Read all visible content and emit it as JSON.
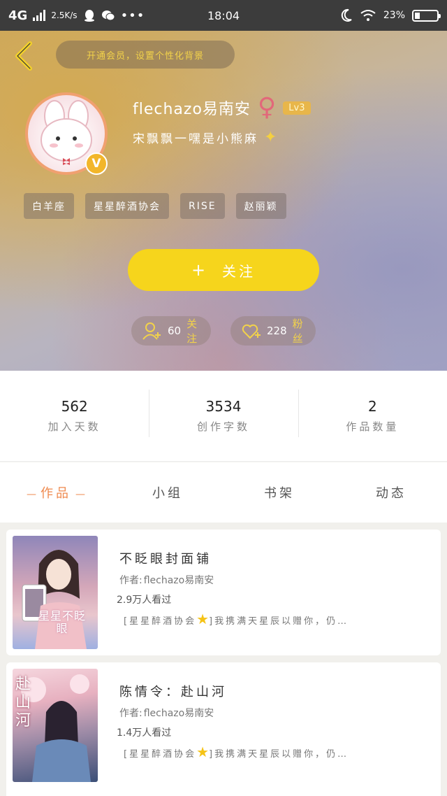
{
  "status_bar": {
    "network": "4G",
    "speed": "2.5K/s",
    "time": "18:04",
    "battery_percent": "23%",
    "battery_level": 0.23
  },
  "header": {
    "vip_banner": "开通会员，设置个性化背景",
    "username": "flechazo易南安",
    "gender_symbol": "♀",
    "level": "Lv3",
    "signature": "宋飘飘一嘿是小熊麻",
    "avatar_badge": "V",
    "tags": [
      "白羊座",
      "星星醉酒协会",
      "RISE",
      "赵丽颖"
    ],
    "follow_label": "关注",
    "following_count": "60",
    "following_label": "关注",
    "fans_count": "228",
    "fans_label": "粉丝"
  },
  "stats": [
    {
      "value": "562",
      "label": "加入天数"
    },
    {
      "value": "3534",
      "label": "创作字数"
    },
    {
      "value": "2",
      "label": "作品数量"
    }
  ],
  "tabs": [
    {
      "label": "作品",
      "active": true
    },
    {
      "label": "小组",
      "active": false
    },
    {
      "label": "书架",
      "active": false
    },
    {
      "label": "动态",
      "active": false
    }
  ],
  "works": [
    {
      "title": "不眨眼封面铺",
      "author_prefix": "作者:",
      "author": "flechazo易南安",
      "views": "2.9万人看过",
      "desc_open": "[星星醉酒协会",
      "desc_close": "]我携满天星辰以赠你，仍…",
      "cover_text": "星星不眨眼"
    },
    {
      "title": "陈情令：赴山河",
      "author_prefix": "作者:",
      "author": "flechazo易南安",
      "views": "1.4万人看过",
      "desc_open": "[星星醉酒协会",
      "desc_close": "]我携满天星辰以赠你，仍…",
      "cover_text": "赴山河"
    }
  ],
  "colors": {
    "accent_yellow": "#f6d51c",
    "active_tab": "#ef8a4f",
    "gender_pink": "#e2687a",
    "level_badge": "#e8b64a"
  }
}
